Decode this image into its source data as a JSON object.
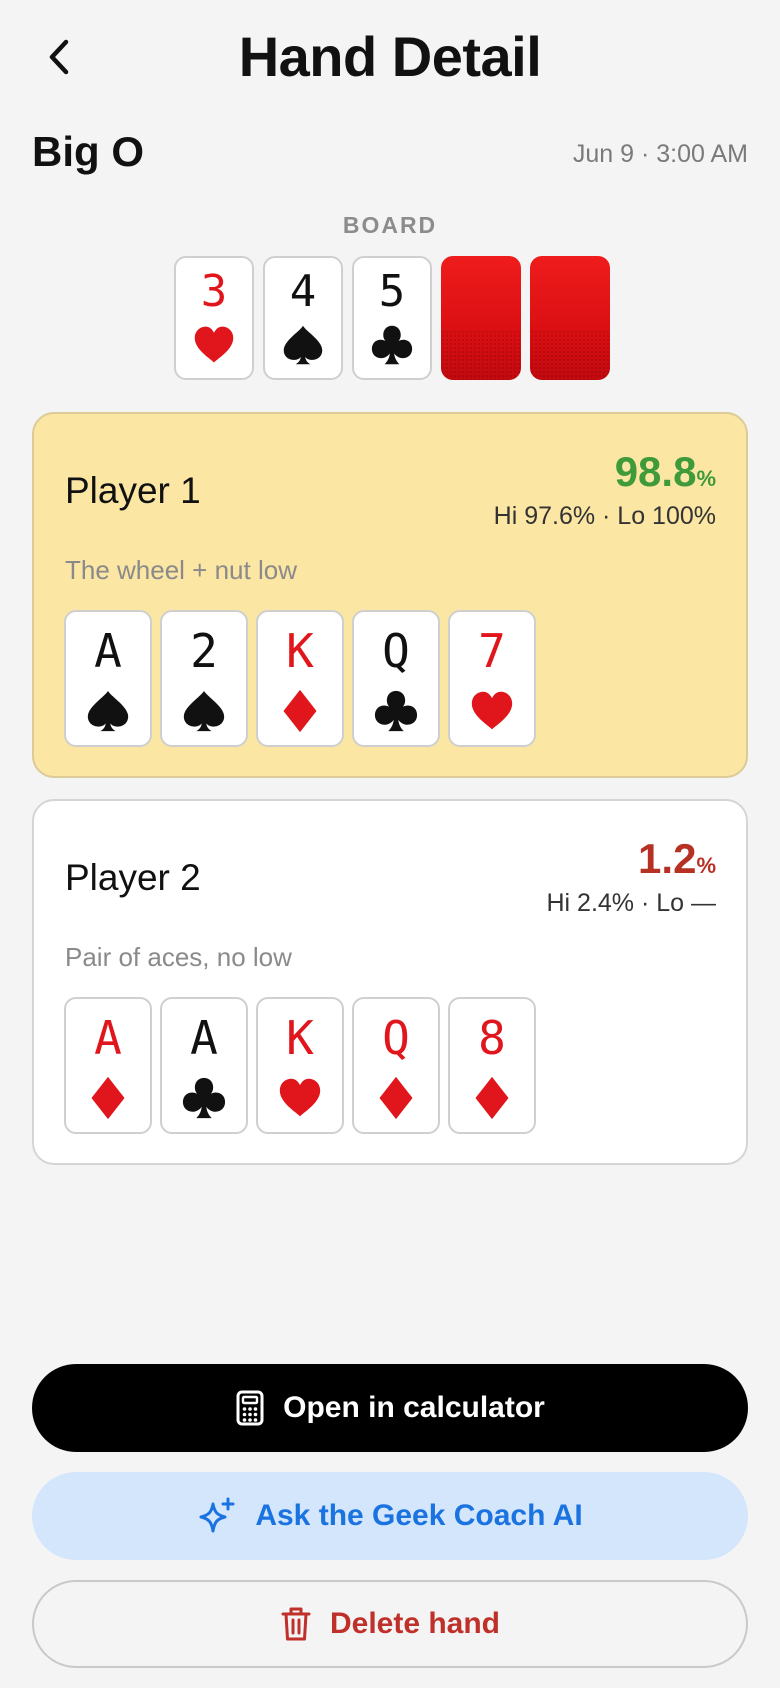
{
  "header": {
    "title": "Hand Detail",
    "back_icon": "chevron-left-icon"
  },
  "game": {
    "name": "Big O",
    "date": "Jun 9 · 3:00 AM"
  },
  "board": {
    "label": "BOARD",
    "cards": [
      {
        "rank": "3",
        "suit": "heart",
        "color": "red"
      },
      {
        "rank": "4",
        "suit": "spade",
        "color": "black"
      },
      {
        "rank": "5",
        "suit": "club",
        "color": "black"
      },
      {
        "face_down": true
      },
      {
        "face_down": true
      }
    ]
  },
  "players": [
    {
      "name": "Player 1",
      "equity": "98.8",
      "equity_unit": "%",
      "split": "Hi 97.6% · Lo 100%",
      "description": "The wheel + nut low",
      "winner": true,
      "cards": [
        {
          "rank": "A",
          "suit": "spade",
          "color": "black"
        },
        {
          "rank": "2",
          "suit": "spade",
          "color": "black"
        },
        {
          "rank": "K",
          "suit": "diamond",
          "color": "red"
        },
        {
          "rank": "Q",
          "suit": "club",
          "color": "black"
        },
        {
          "rank": "7",
          "suit": "heart",
          "color": "red"
        }
      ]
    },
    {
      "name": "Player 2",
      "equity": "1.2",
      "equity_unit": "%",
      "split": "Hi 2.4% · Lo —",
      "description": "Pair of aces, no low",
      "winner": false,
      "cards": [
        {
          "rank": "A",
          "suit": "diamond",
          "color": "red"
        },
        {
          "rank": "A",
          "suit": "club",
          "color": "black"
        },
        {
          "rank": "K",
          "suit": "heart",
          "color": "red"
        },
        {
          "rank": "Q",
          "suit": "diamond",
          "color": "red"
        },
        {
          "rank": "8",
          "suit": "diamond",
          "color": "red"
        }
      ]
    }
  ],
  "actions": {
    "calculator": {
      "label": "Open in calculator",
      "icon": "calculator-icon"
    },
    "coach": {
      "label": "Ask the Geek Coach AI",
      "icon": "sparkles-icon"
    },
    "delete": {
      "label": "Delete hand",
      "icon": "trash-icon"
    }
  },
  "colors": {
    "background": "#f4f4f4",
    "winner_bg": "#fbe6a3",
    "equity_win": "#3f9a3a",
    "equity_lose": "#b63024",
    "card_red": "#e0161c",
    "coach_bg": "#d4e6fb",
    "coach_text": "#1a73e0",
    "delete_text": "#c0302a"
  }
}
